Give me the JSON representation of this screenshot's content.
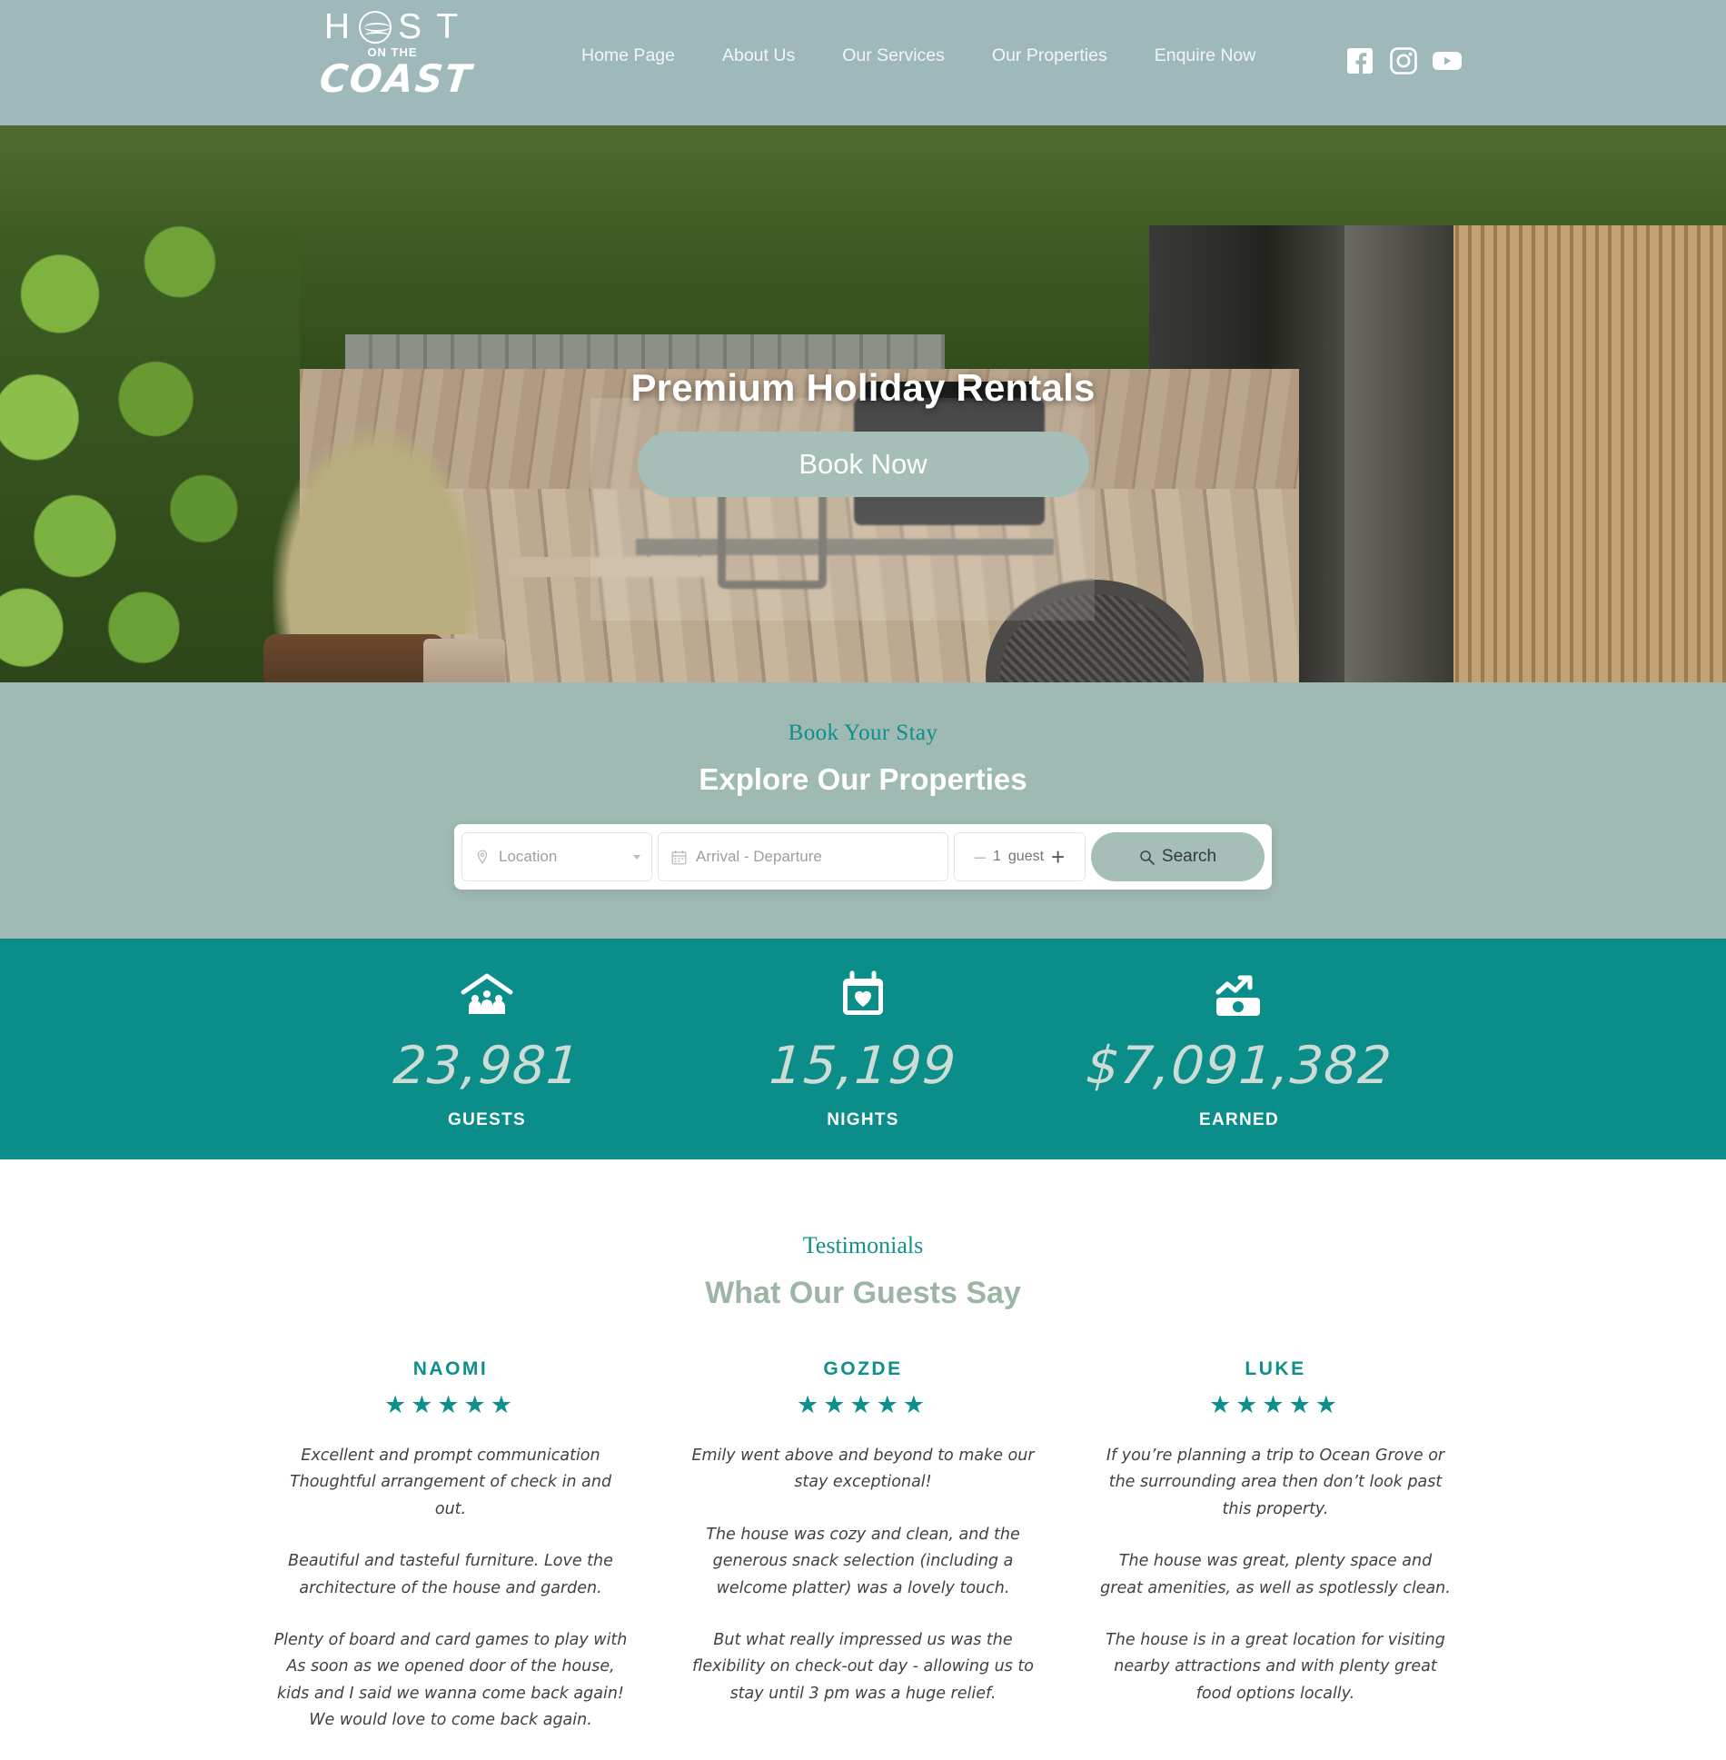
{
  "header": {
    "logo": {
      "top": "H ST",
      "middle": "ON THE",
      "bottom": "COAST",
      "sun_icon": "sun-wave-icon"
    },
    "nav": [
      {
        "label": "Home Page"
      },
      {
        "label": "About Us"
      },
      {
        "label": "Our Services"
      },
      {
        "label": "Our Properties"
      },
      {
        "label": "Enquire Now"
      }
    ],
    "socials": [
      {
        "name": "facebook-icon"
      },
      {
        "name": "instagram-icon"
      },
      {
        "name": "youtube-icon"
      }
    ]
  },
  "hero": {
    "title": "Premium Holiday Rentals",
    "cta": "Book Now"
  },
  "search": {
    "eyebrow": "Book Your Stay",
    "title": "Explore Our Properties",
    "location_placeholder": "Location",
    "dates_placeholder": "Arrival - Departure",
    "guest_minus": "–",
    "guest_count": "1",
    "guest_word": "guest",
    "guest_plus": "+",
    "search_label": "Search"
  },
  "stats": [
    {
      "icon": "house-family-icon",
      "value": "23,981",
      "label": "GUESTS"
    },
    {
      "icon": "calendar-heart-icon",
      "value": "15,199",
      "label": "NIGHTS"
    },
    {
      "icon": "chart-money-icon",
      "value": "$7,091,382",
      "label": "EARNED"
    }
  ],
  "testimonials": {
    "eyebrow": "Testimonials",
    "title": "What Our Guests Say",
    "stars": "★★★★★",
    "cards": [
      {
        "name": "NAOMI",
        "rating": 5,
        "paragraphs": [
          "Excellent and prompt communication Thoughtful arrangement of check in and out.",
          "Beautiful and tasteful furniture. Love the architecture of the house and garden.",
          "Plenty of board and card games to play with As soon as we opened door of the house, kids and I said we wanna come back again! We would love to come back again."
        ]
      },
      {
        "name": "GOZDE",
        "rating": 5,
        "paragraphs": [
          "Emily went above and beyond to make our stay exceptional!",
          "The house was cozy and clean, and the generous snack selection (including a welcome platter) was a lovely touch.",
          "But what really impressed us was the flexibility on check-out day - allowing us to stay until 3 pm was a huge relief."
        ]
      },
      {
        "name": "LUKE",
        "rating": 5,
        "paragraphs": [
          "If you’re planning a trip to Ocean Grove or the surrounding area then don’t look past this property.",
          "The house was great, plenty space and great amenities, as well as spotlessly clean.",
          "The house is in a great location for visiting nearby attractions and with plenty great food options locally."
        ]
      }
    ]
  },
  "colors": {
    "header_bg": "#9fb9bb",
    "search_bg": "#9fb9b3",
    "teal": "#0b8e8a",
    "sage_button": "#a5bfb8"
  }
}
